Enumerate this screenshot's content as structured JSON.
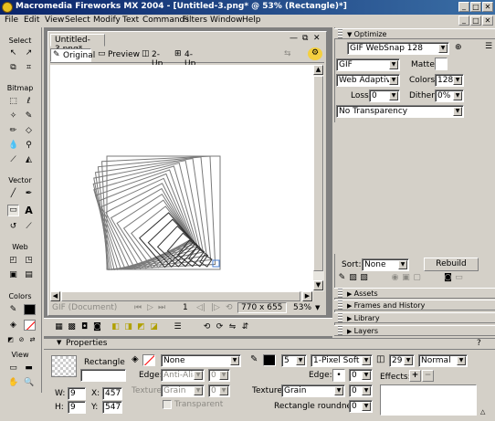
{
  "window": {
    "title": "Macromedia Fireworks MX 2004 - [Untitled-3.png* @ 53% (Rectangle)*]"
  },
  "menu": [
    "File",
    "Edit",
    "View",
    "Select",
    "Modify",
    "Text",
    "Commands",
    "Filters",
    "Window",
    "Help"
  ],
  "tools": {
    "select": "Select",
    "bitmap": "Bitmap",
    "vector": "Vector",
    "web": "Web",
    "colors": "Colors",
    "view": "View"
  },
  "document": {
    "tab": "Untitled-3.png*",
    "views": {
      "original": "Original",
      "preview": "Preview",
      "two_up": "2-Up",
      "four_up": "4-Up"
    },
    "status": {
      "format": "GIF (Document)",
      "frame": "1",
      "size": "770 x 655",
      "zoom": "53%"
    }
  },
  "optimize": {
    "title": "Optimize",
    "settings": "GIF WebSnap 128",
    "format": "GIF",
    "matte_label": "Matte",
    "palette": "Web Adaptive",
    "colors_label": "Colors",
    "colors": "128",
    "loss_label": "Loss:",
    "loss": "0",
    "dither_label": "Dither",
    "dither": "0%",
    "transparency": "No Transparency",
    "sort_label": "Sort:",
    "sort": "None",
    "rebuild": "Rebuild"
  },
  "panels": [
    "Assets",
    "Frames and History",
    "Library",
    "Layers"
  ],
  "properties": {
    "title": "Properties",
    "object": "Rectangle",
    "fill": "None",
    "edge_label": "Edge:",
    "edge": "Anti-Alias",
    "edge_val": "0",
    "texture_label": "Texture:",
    "texture": "Grain",
    "texture_val": "0",
    "transparent": "Transparent",
    "w_label": "W:",
    "w": "9",
    "x_label": "X:",
    "x": "457",
    "h_label": "H:",
    "h": "9",
    "y_label": "Y:",
    "y": "547",
    "stroke_size": "5",
    "stroke": "1-Pixel Soft",
    "stroke_edge_label": "Edge:",
    "stroke_edge": "0",
    "stroke_texture_label": "Texture:",
    "stroke_texture": "Grain",
    "stroke_texture_val": "0",
    "roundness_label": "Rectangle roundness:",
    "roundness": "0",
    "opacity": "29",
    "blend": "Normal",
    "effects_label": "Effects:"
  },
  "colors": {
    "titlebar": "#0a246a",
    "canvas": "#ffffff",
    "chrome": "#d4d0c8",
    "fill_swatch": "#ff0000"
  }
}
